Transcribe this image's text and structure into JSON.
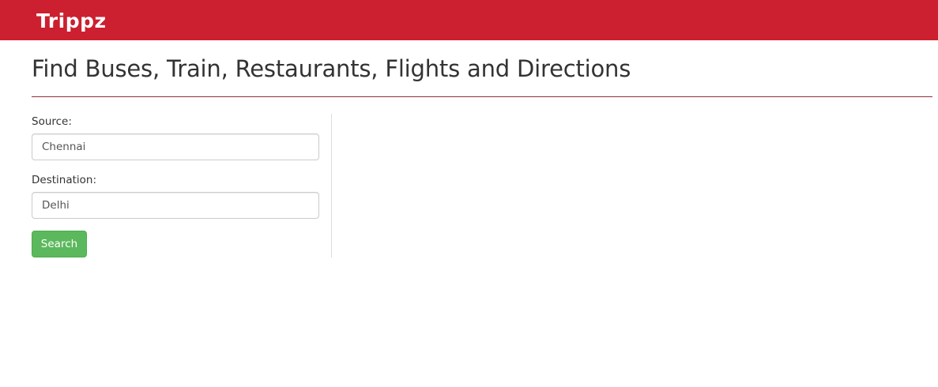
{
  "navbar": {
    "brand": "Trippz",
    "background_color": "#cc1f2f"
  },
  "header": {
    "title": "Find Buses, Train, Restaurants, Flights and Directions"
  },
  "form": {
    "source": {
      "label": "Source:",
      "value": "Chennai"
    },
    "destination": {
      "label": "Destination:",
      "value": "Delhi"
    },
    "search_button": {
      "label": "Search",
      "color": "#5cb85c"
    }
  }
}
